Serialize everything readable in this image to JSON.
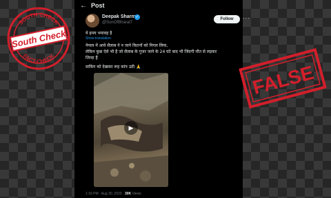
{
  "post": {
    "header_title": "Post",
    "author_name": "Deepak Sharma",
    "author_handle": "@SonOfBharat7",
    "follow_label": "Follow",
    "line1": "ये हमय भयावह है",
    "translate_label": "Show translation",
    "line2": "नेपाल में आये सैलाब ने न जाने कितनों को निगल लिया,",
    "line3": "लेकिन कुछ ऐसे भी है जो सैलाब के गुजर जाने के 24 घंटे बाद भी जिंदगी मौत से लड़कर",
    "line4": "जिन्दा हैं",
    "line5": "वाकिंग को देखकर रूह कांप उठी 🙏",
    "meta_time": "1:16 PM · Aug 30, 2020 ·",
    "meta_views_count": "30K",
    "meta_views_label": "Views"
  },
  "logo": {
    "top_text": "SOUTH CHECK",
    "bottom_text": "FACT-CHECK",
    "brand": "South Check"
  },
  "stamp": {
    "label": "FALSE"
  },
  "colors": {
    "accent_blue": "#1d9bf0",
    "stamp_red": "#d21f2b"
  },
  "icons": {
    "back": "back-arrow-icon",
    "verified": "verified-badge-icon",
    "more": "more-options-icon",
    "play": "play-icon"
  }
}
